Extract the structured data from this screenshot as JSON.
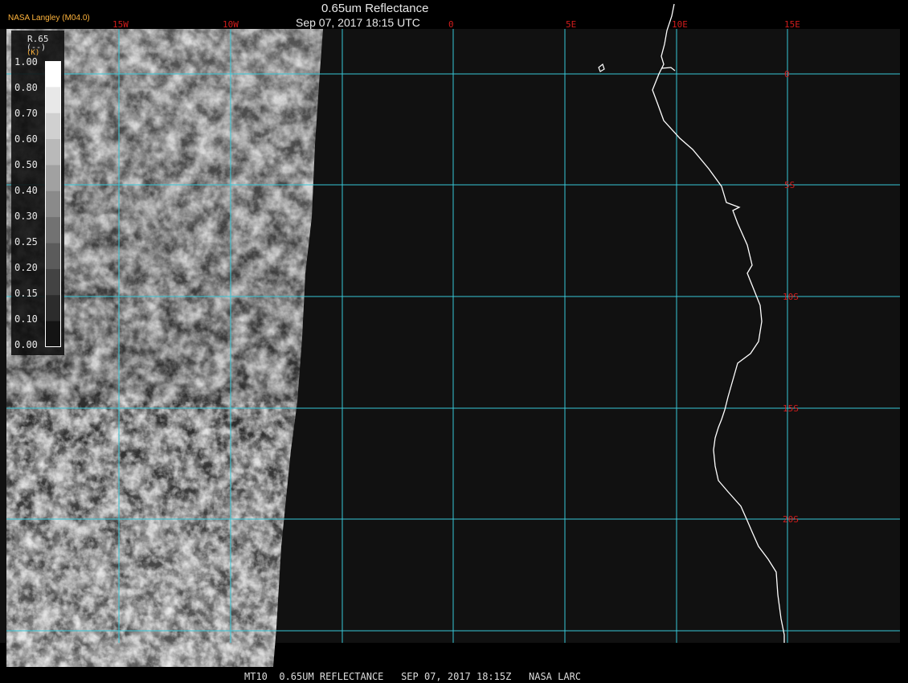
{
  "header": {
    "title": "0.65um Reflectance",
    "subtitle": "Sep 07, 2017 18:15 UTC",
    "producer": "NASA Langley (M04.0)"
  },
  "map": {
    "lon_labels": [
      "15W",
      "10W",
      "0",
      "5E",
      "10E",
      "15E"
    ],
    "lat_labels": [
      "0",
      "5S",
      "10S",
      "15S",
      "20S"
    ],
    "grid_color": "#38c8d8",
    "label_color": "#d21c1c",
    "coastline_color": "#ffffff",
    "background_color": "#111111"
  },
  "legend": {
    "variable": "R.65",
    "unit": "(--)",
    "unit_tag": "(K)",
    "ticks": [
      "1.00",
      "0.80",
      "0.70",
      "0.60",
      "0.50",
      "0.40",
      "0.30",
      "0.25",
      "0.20",
      "0.15",
      "0.10",
      "0.00"
    ]
  },
  "footer": {
    "text": "MT10  0.65UM REFLECTANCE   SEP 07, 2017 18:15Z   NASA LARC"
  }
}
